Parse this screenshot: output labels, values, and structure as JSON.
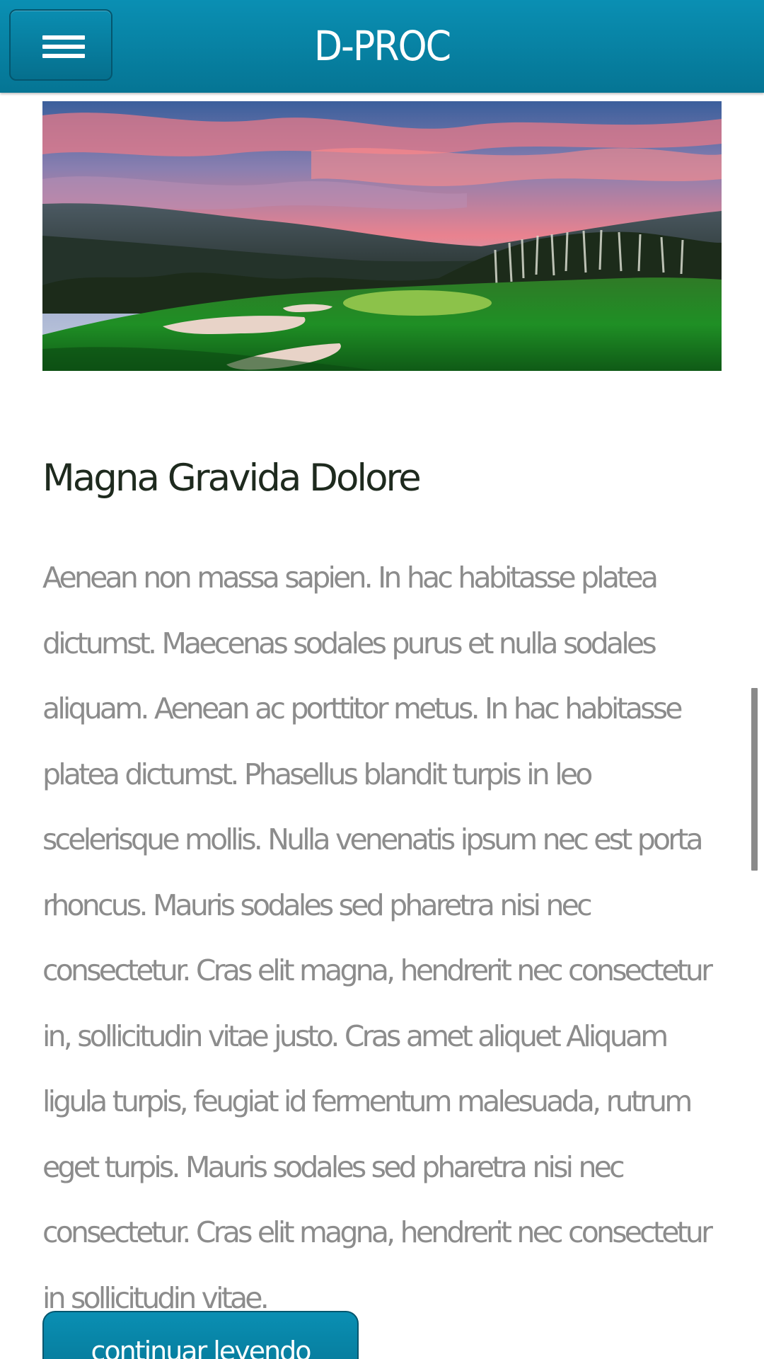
{
  "header": {
    "title": "D-PROC",
    "menu_icon": "hamburger-menu-icon",
    "background_color": "#0a87aa"
  },
  "hero": {
    "description_icon": "golf-course-landscape-image"
  },
  "article": {
    "title": "Magna Gravida Dolore",
    "body": "Aenean non massa sapien. In hac habitasse platea dictumst. Maecenas sodales purus et nulla sodales aliquam. Aenean ac porttitor metus. In hac habitasse platea dictumst. Phasellus blandit turpis in leo scelerisque mollis. Nulla venenatis ipsum nec est porta rhoncus. Mauris sodales sed pharetra nisi nec consectetur. Cras elit magna, hendrerit nec consectetur in, sollicitudin vitae justo. Cras amet aliquet Aliquam ligula turpis, feugiat id fermentum malesuada, rutrum eget turpis. Mauris sodales sed pharetra nisi nec consectetur. Cras elit magna, hendrerit nec consectetur in sollicitudin vitae.",
    "continue_label": "continuar leyendo"
  },
  "colors": {
    "title_text": "#1e2a1e",
    "body_text": "#8c8c8c",
    "accent": "#0a87aa"
  }
}
